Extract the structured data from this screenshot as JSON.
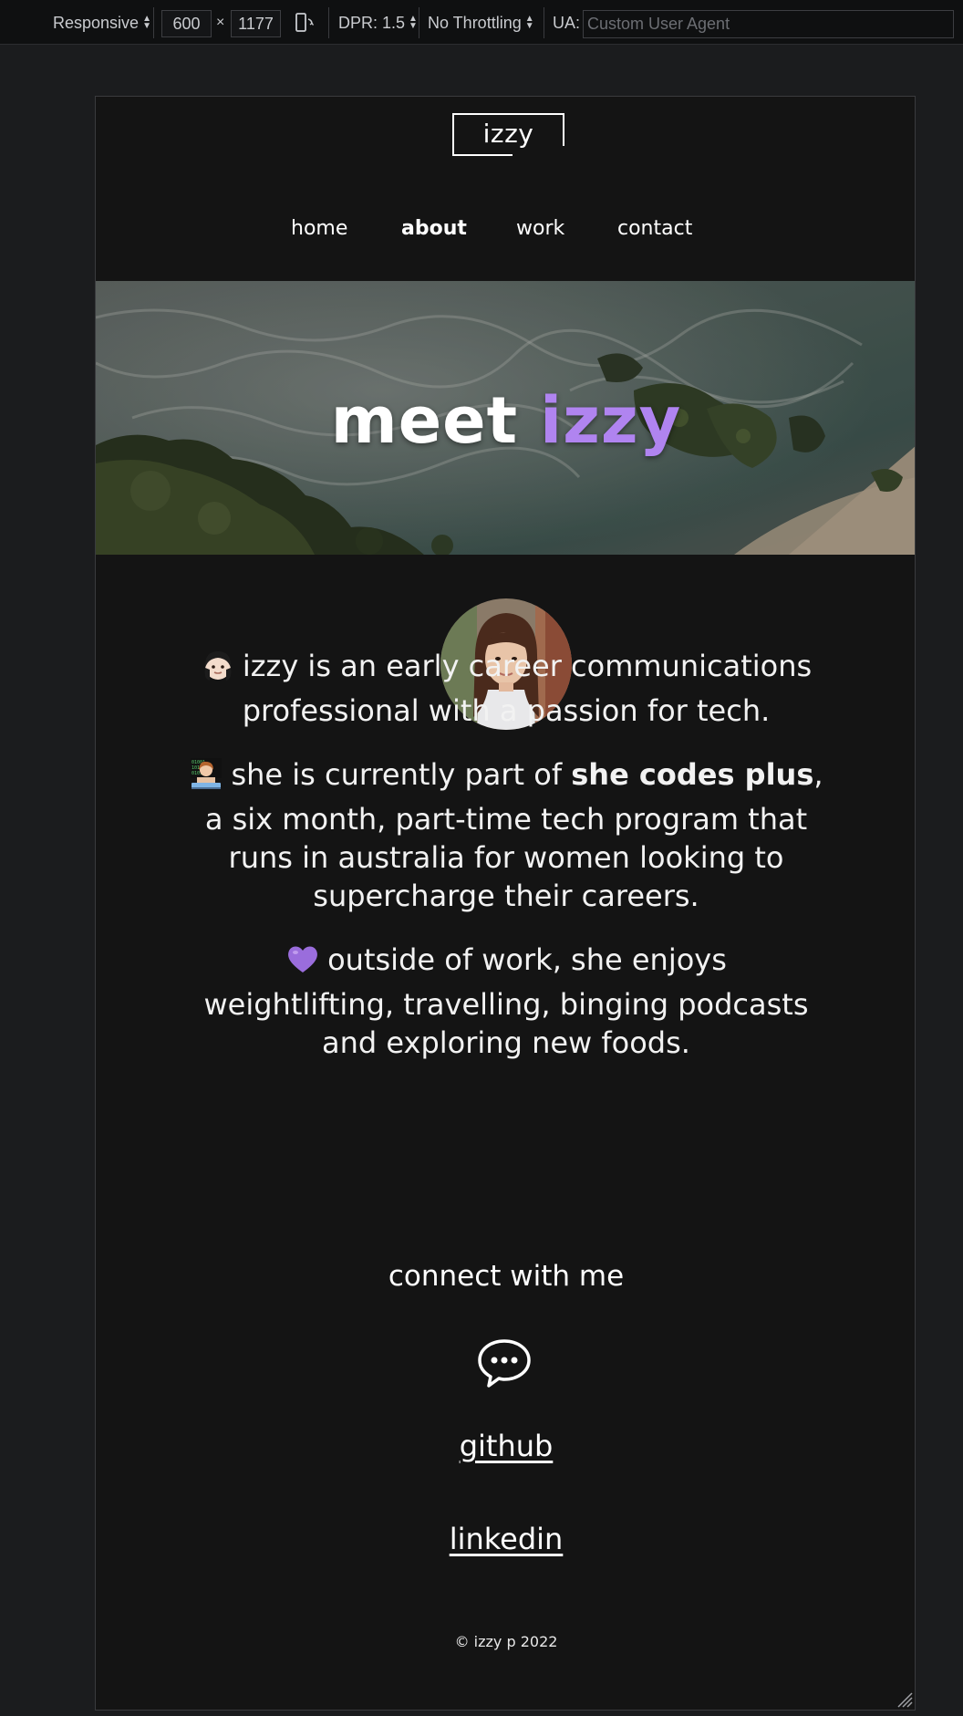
{
  "devtools": {
    "device_mode": "Responsive",
    "width": "600",
    "times": "×",
    "height": "1177",
    "dpr": "DPR: 1.5",
    "throttling": "No Throttling",
    "ua_label": "UA:",
    "ua_placeholder": "Custom User Agent"
  },
  "site": {
    "logo": "izzy",
    "nav": [
      {
        "label": "home",
        "active": false
      },
      {
        "label": "about",
        "active": true
      },
      {
        "label": "work",
        "active": false
      },
      {
        "label": "contact",
        "active": false
      }
    ],
    "hero": {
      "title_plain": "meet",
      "title_accent": "izzy"
    },
    "bio": [
      {
        "emoji": "woman-emoji",
        "text": "izzy is an early career communications professional with a passion for tech."
      },
      {
        "emoji": "woman-technologist-emoji",
        "text_before": "she is currently part of ",
        "bold": "she codes plus",
        "text_after": ", a six month, part-time tech program that runs in australia for women looking to supercharge their careers."
      },
      {
        "emoji": "purple-heart-emoji",
        "text": "outside of work, she enjoys weightlifting, travelling, binging podcasts and exploring new foods."
      }
    ],
    "connect": {
      "title": "connect with me",
      "icon": "chat-bubble-icon",
      "links": [
        "github",
        "linkedin"
      ]
    },
    "footer": "© izzy p 2022"
  },
  "colors": {
    "accent": "#b084f0",
    "background": "#141414",
    "text": "#ffffff"
  }
}
